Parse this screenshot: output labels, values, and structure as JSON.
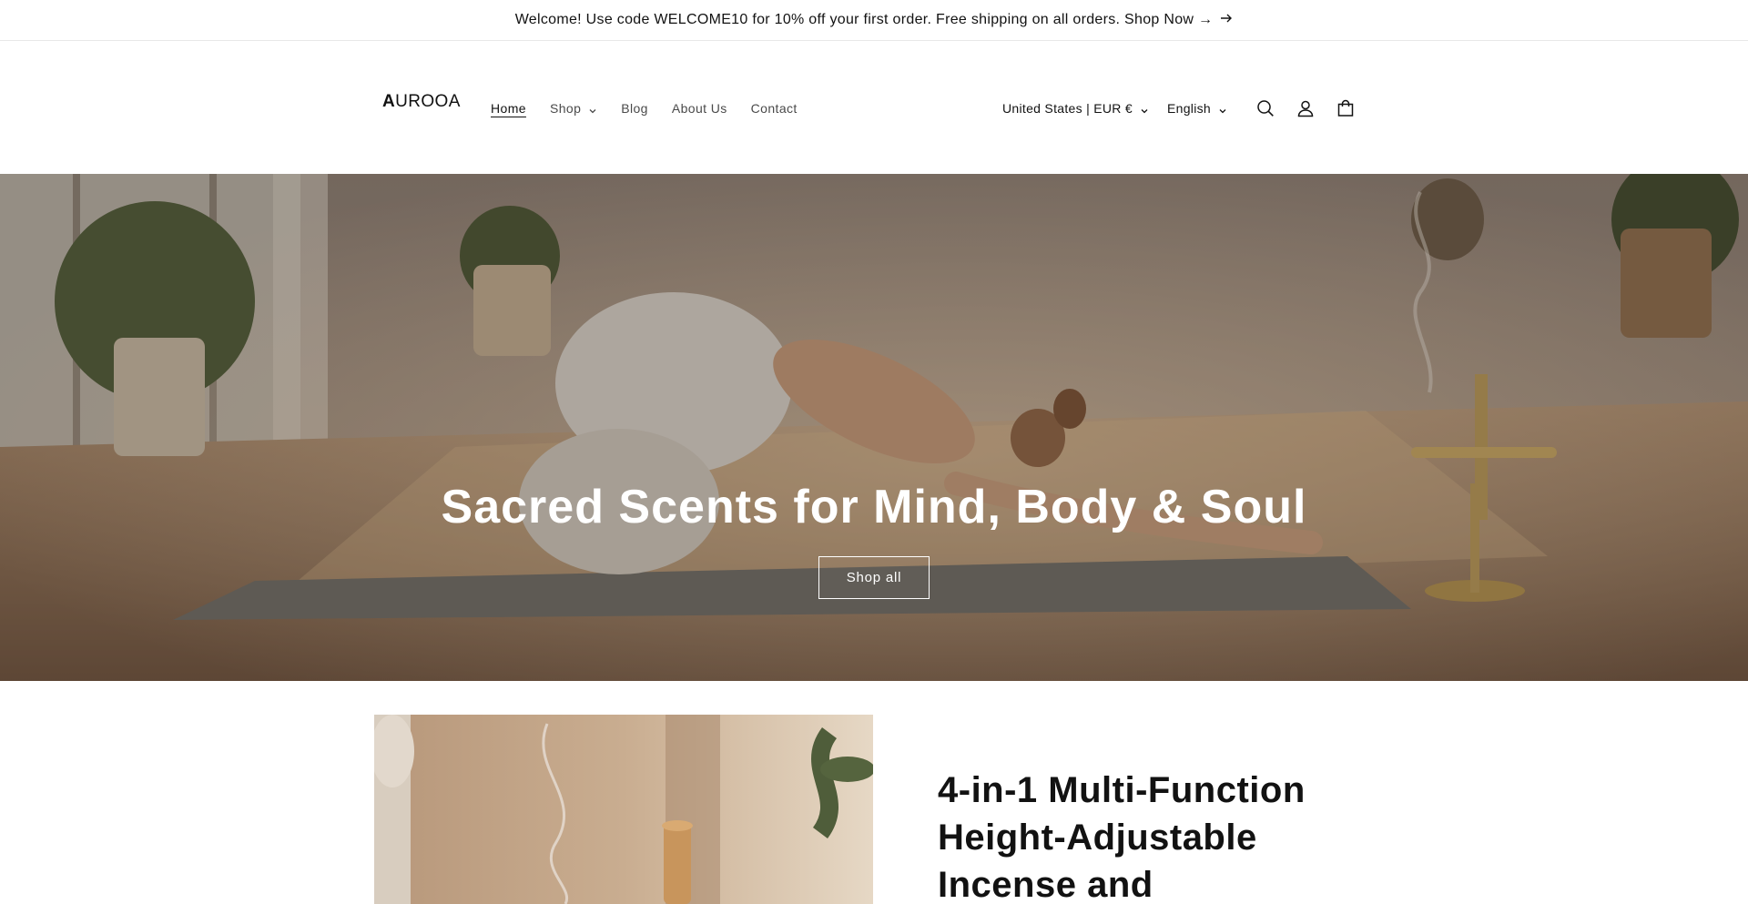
{
  "announcement": {
    "text": "Welcome! Use code WELCOME10 for 10% off your first order. Free shipping on all orders. Shop Now →",
    "arrow_icon": "arrow-right-icon"
  },
  "header": {
    "logo_first": "A",
    "logo_rest": "UROOA",
    "nav": [
      {
        "label": "Home",
        "active": true
      },
      {
        "label": "Shop",
        "dropdown": true
      },
      {
        "label": "Blog"
      },
      {
        "label": "About Us"
      },
      {
        "label": "Contact"
      }
    ],
    "country_selector": "United States | EUR €",
    "language_selector": "English",
    "icons": [
      "search-icon",
      "account-icon",
      "cart-icon"
    ]
  },
  "hero": {
    "title": "Sacred Scents for Mind, Body & Soul",
    "button_label": "Shop all"
  },
  "feature": {
    "title": "4-in-1 Multi-Function Height-Adjustable Incense and"
  },
  "colors": {
    "text": "#121212",
    "hero_overlay": "#3a2f25",
    "background": "#ffffff"
  }
}
